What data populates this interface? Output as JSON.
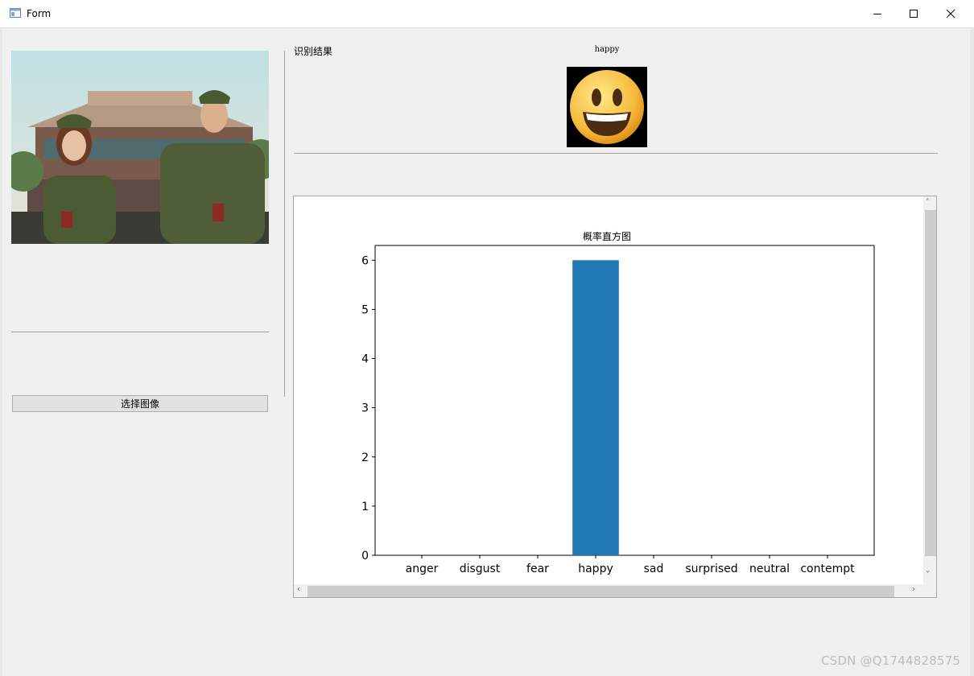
{
  "window": {
    "title": "Form",
    "controls": [
      "minimize-icon",
      "maximize-icon",
      "close-icon"
    ]
  },
  "left_panel": {
    "image_alt": "selected photo",
    "select_button_label": "选择图像"
  },
  "result": {
    "label": "识别结果",
    "emotion": "happy",
    "emoji_icon": "smiley-face-icon"
  },
  "colors": {
    "bar": "#1f77b4",
    "background": "#f0f0f0"
  },
  "chart_data": {
    "type": "bar",
    "title": "概率直方图",
    "categories": [
      "anger",
      "disgust",
      "fear",
      "happy",
      "sad",
      "surprised",
      "neutral",
      "contempt"
    ],
    "values": [
      0,
      0,
      0,
      6,
      0,
      0,
      0,
      0
    ],
    "xlabel": "",
    "ylabel": "",
    "ylim": [
      0,
      6.3
    ],
    "yticks": [
      0,
      1,
      2,
      3,
      4,
      5,
      6
    ],
    "grid": false
  },
  "watermark": "CSDN @Q1744828575"
}
